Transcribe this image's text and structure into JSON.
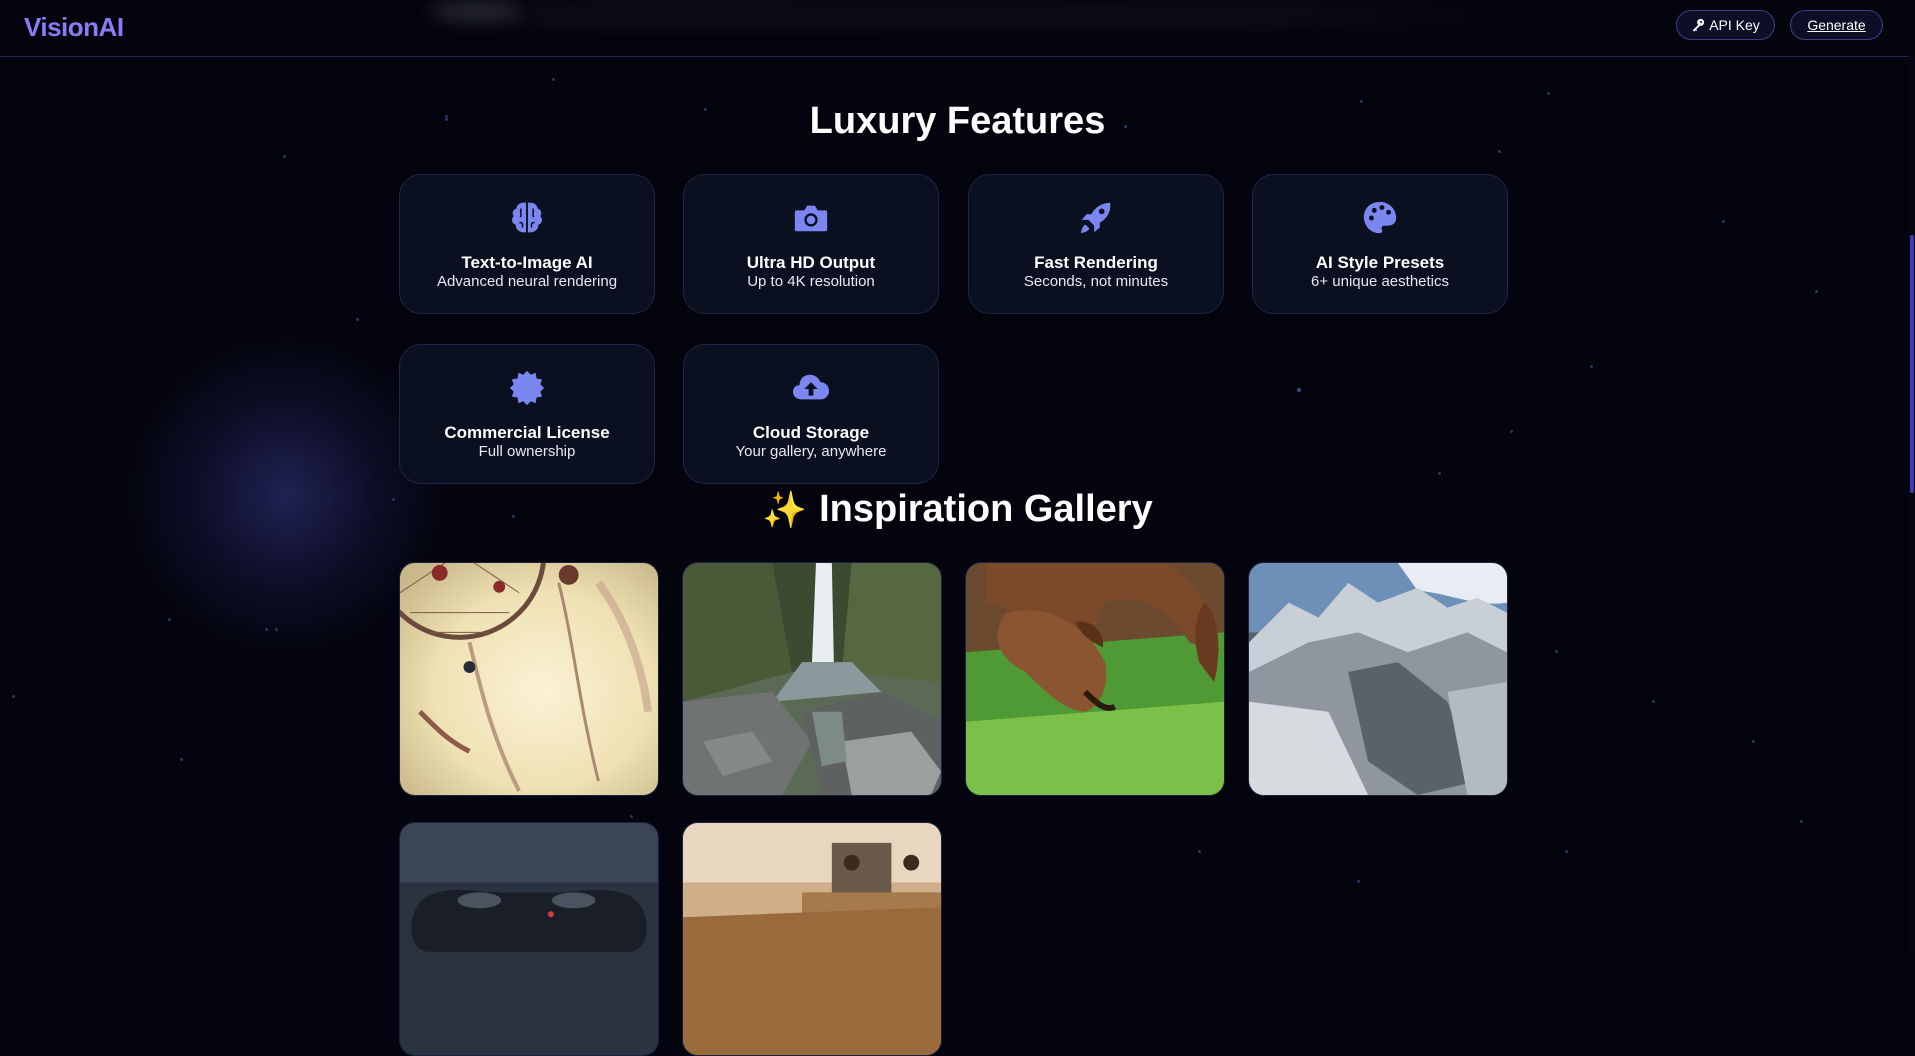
{
  "header": {
    "logo": "VisionAI",
    "api_key_label": "API Key",
    "generate_label": "Generate"
  },
  "features": {
    "title": "Luxury Features",
    "items": [
      {
        "icon": "brain-icon",
        "title": "Text-to-Image AI",
        "subtitle": "Advanced neural rendering"
      },
      {
        "icon": "camera-icon",
        "title": "Ultra HD Output",
        "subtitle": "Up to 4K resolution"
      },
      {
        "icon": "rocket-icon",
        "title": "Fast Rendering",
        "subtitle": "Seconds, not minutes"
      },
      {
        "icon": "palette-icon",
        "title": "AI Style Presets",
        "subtitle": "6+ unique aesthetics"
      },
      {
        "icon": "certificate-icon",
        "title": "Commercial License",
        "subtitle": "Full ownership"
      },
      {
        "icon": "cloud-upload-icon",
        "title": "Cloud Storage",
        "subtitle": "Your gallery, anywhere"
      }
    ]
  },
  "gallery": {
    "emoji": "✨",
    "title": "Inspiration Gallery",
    "images": [
      "dreamcatcher",
      "waterfall-rocks",
      "dogs-grass",
      "mountain-range",
      "game-controller",
      "cafe-table"
    ]
  },
  "colors": {
    "background": "#03040d",
    "accent": "#8b7cf6",
    "icon": "#7b86f0",
    "card": "#0b1020",
    "card_border": "#1f2547"
  }
}
